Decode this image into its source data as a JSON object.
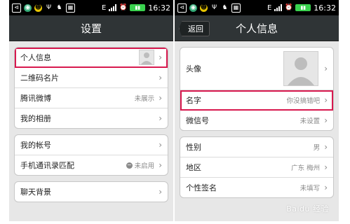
{
  "statusbar": {
    "time": "16:32",
    "network": "E",
    "icons": [
      "usb-icon",
      "qq-icon",
      "cat-icon",
      "usb-icon",
      "android-icon",
      "app-icon"
    ]
  },
  "left": {
    "title": "设置",
    "groups": [
      [
        {
          "label": "个人信息",
          "value": ""
        },
        {
          "label": "二维码名片",
          "value": ""
        },
        {
          "label": "腾讯微博",
          "value": "未展示"
        },
        {
          "label": "我的相册",
          "value": ""
        }
      ],
      [
        {
          "label": "我的帐号",
          "value": ""
        },
        {
          "label": "手机通讯录匹配",
          "value": "未启用"
        }
      ],
      [
        {
          "label": "聊天背景",
          "value": ""
        }
      ]
    ]
  },
  "right": {
    "title": "个人信息",
    "back_label": "返回",
    "groups": [
      [
        {
          "label": "头像",
          "value": ""
        },
        {
          "label": "名字",
          "value": "你没搞错吧"
        },
        {
          "label": "微信号",
          "value": "未设置"
        }
      ],
      [
        {
          "label": "性别",
          "value": "男"
        },
        {
          "label": "地区",
          "value": "广东 梅州"
        },
        {
          "label": "个性签名",
          "value": "未填写"
        }
      ]
    ]
  },
  "colors": {
    "accent_highlight": "#d8194f",
    "titlebar": "#2f3436",
    "background": "#e7e7e7"
  }
}
